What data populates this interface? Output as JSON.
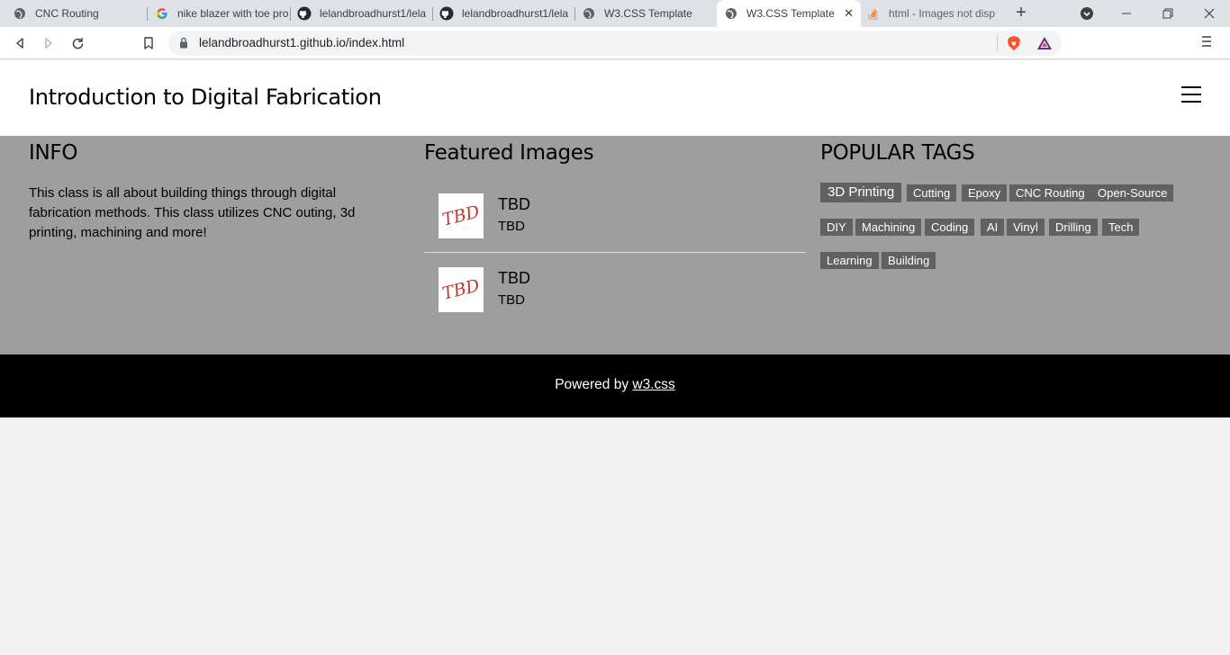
{
  "browser": {
    "tabs": [
      {
        "title": "CNC Routing",
        "icon": "globe-icon",
        "active": false
      },
      {
        "title": "nike blazer with toe pro",
        "icon": "google-icon",
        "active": false
      },
      {
        "title": "lelandbroadhurst1/lela",
        "icon": "github-icon",
        "active": false
      },
      {
        "title": "lelandbroadhurst1/lela",
        "icon": "github-icon",
        "active": false
      },
      {
        "title": "W3.CSS Template",
        "icon": "globe-icon",
        "active": false
      },
      {
        "title": "W3.CSS Template",
        "icon": "globe-icon",
        "active": true
      },
      {
        "title": "html - Images not disp",
        "icon": "stackoverflow-icon",
        "active": false
      }
    ],
    "new_tab_label": "+",
    "url": "lelandbroadhurst1.github.io/index.html"
  },
  "site": {
    "title": "Introduction to Digital Fabrication",
    "info": {
      "heading": "INFO",
      "text": "This class is all about building things through digital fabrication methods. This class utilizes CNC outing, 3d printing, machining and more!"
    },
    "featured": {
      "heading": "Featured Images",
      "items": [
        {
          "thumb_text": "TBD",
          "title": "TBD",
          "subtitle": "TBD"
        },
        {
          "thumb_text": "TBD",
          "title": "TBD",
          "subtitle": "TBD"
        }
      ]
    },
    "tags": {
      "heading": "POPULAR TAGS",
      "items": [
        "3D Printing",
        "Cutting",
        "Epoxy",
        "CNC Routing",
        "Open-Source",
        "DIY",
        "Machining",
        "Coding",
        "AI",
        "Vinyl",
        "Drilling",
        "Tech",
        "Learning",
        "Building"
      ]
    },
    "footer": {
      "prefix": "Powered by ",
      "link": "w3.css"
    }
  },
  "colors": {
    "section_bg": "#9e9e9e",
    "tag_bg": "#616161",
    "footer_bg": "#000000",
    "thumb_text": "#c0392b"
  }
}
